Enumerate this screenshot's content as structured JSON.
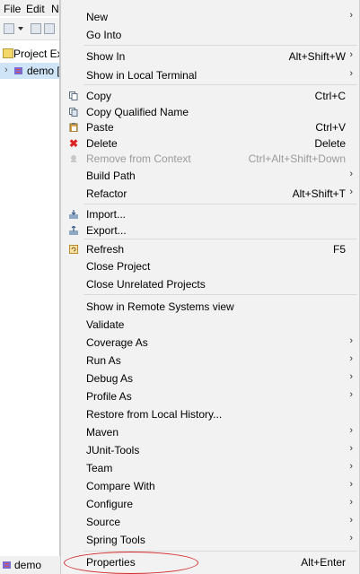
{
  "ide": {
    "menubar": [
      "File",
      "Edit",
      "N"
    ],
    "explorer_title": "Project Exp",
    "tree_item": "demo [",
    "status_label": "demo"
  },
  "menu": {
    "items": [
      {
        "label": "New",
        "submenu": true
      },
      {
        "label": "Go Into"
      },
      {
        "label": "Show In",
        "shortcut": "Alt+Shift+W",
        "submenu": true
      },
      {
        "label": "Show in Local Terminal",
        "submenu": true
      },
      {
        "label": "Copy",
        "shortcut": "Ctrl+C",
        "icon": "copy-icon"
      },
      {
        "label": "Copy Qualified Name",
        "icon": "copy-qualified-name-icon"
      },
      {
        "label": "Paste",
        "shortcut": "Ctrl+V",
        "icon": "paste-icon"
      },
      {
        "label": "Delete",
        "shortcut": "Delete",
        "icon": "delete-icon"
      },
      {
        "label": "Remove from Context",
        "shortcut": "Ctrl+Alt+Shift+Down",
        "icon": "remove-context-icon",
        "disabled": true
      },
      {
        "label": "Build Path",
        "submenu": true
      },
      {
        "label": "Refactor",
        "shortcut": "Alt+Shift+T",
        "submenu": true
      },
      {
        "label": "Import...",
        "icon": "import-icon"
      },
      {
        "label": "Export...",
        "icon": "export-icon"
      },
      {
        "label": "Refresh",
        "shortcut": "F5",
        "icon": "refresh-icon"
      },
      {
        "label": "Close Project"
      },
      {
        "label": "Close Unrelated Projects"
      },
      {
        "label": "Show in Remote Systems view"
      },
      {
        "label": "Validate"
      },
      {
        "label": "Coverage As",
        "submenu": true
      },
      {
        "label": "Run As",
        "submenu": true
      },
      {
        "label": "Debug As",
        "submenu": true
      },
      {
        "label": "Profile As",
        "submenu": true
      },
      {
        "label": "Restore from Local History..."
      },
      {
        "label": "Maven",
        "submenu": true
      },
      {
        "label": "JUnit-Tools",
        "submenu": true
      },
      {
        "label": "Team",
        "submenu": true
      },
      {
        "label": "Compare With",
        "submenu": true
      },
      {
        "label": "Configure",
        "submenu": true
      },
      {
        "label": "Source",
        "submenu": true
      },
      {
        "label": "Spring Tools",
        "submenu": true
      },
      {
        "label": "Properties",
        "shortcut": "Alt+Enter",
        "highlighted": true
      }
    ]
  },
  "colors": {
    "menu_bg": "#f2f2f2",
    "separator": "#d9d9d9",
    "highlight_ellipse": "#d42a2a",
    "disabled_text": "#9b9b9b",
    "selected_row": "#cfe4f7"
  }
}
